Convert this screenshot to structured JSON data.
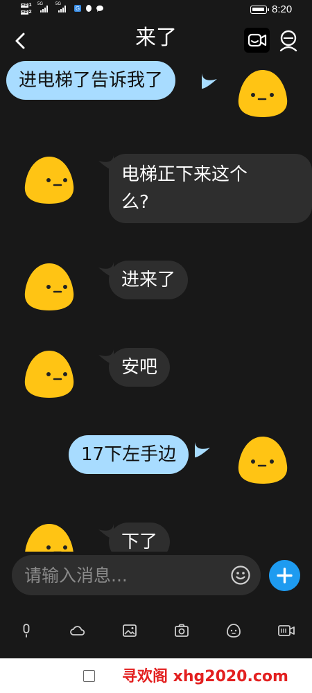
{
  "status_bar": {
    "time": "8:20",
    "sim1_label": "HD",
    "sim1_num": "1",
    "sim2_label": "HD",
    "sim2_num": "2",
    "net1": "5G",
    "net2": "5G"
  },
  "header": {
    "title": "来了"
  },
  "messages": [
    {
      "side": "out",
      "text": "进电梯了告诉我了"
    },
    {
      "side": "in",
      "text_line1": "电梯正下来这个",
      "text_line2": "么?"
    },
    {
      "side": "in",
      "text": "进来了"
    },
    {
      "side": "in",
      "text": "安吧"
    },
    {
      "side": "out",
      "text": "17下左手边"
    },
    {
      "side": "in",
      "text": "下了"
    }
  ],
  "composer": {
    "placeholder": "请输入消息..."
  },
  "toolbar": {
    "icons": [
      "microphone-icon",
      "cloud-icon",
      "image-icon",
      "camera-icon",
      "emoticon-icon",
      "gif-icon"
    ]
  },
  "watermark": "寻欢阁 xhg2020.com",
  "colors": {
    "background": "#181818",
    "bubble_in": "#2e2e2e",
    "bubble_out": "#a8dcff",
    "accent": "#1e9bf0",
    "avatar": "#ffc414",
    "watermark": "#e32020"
  }
}
